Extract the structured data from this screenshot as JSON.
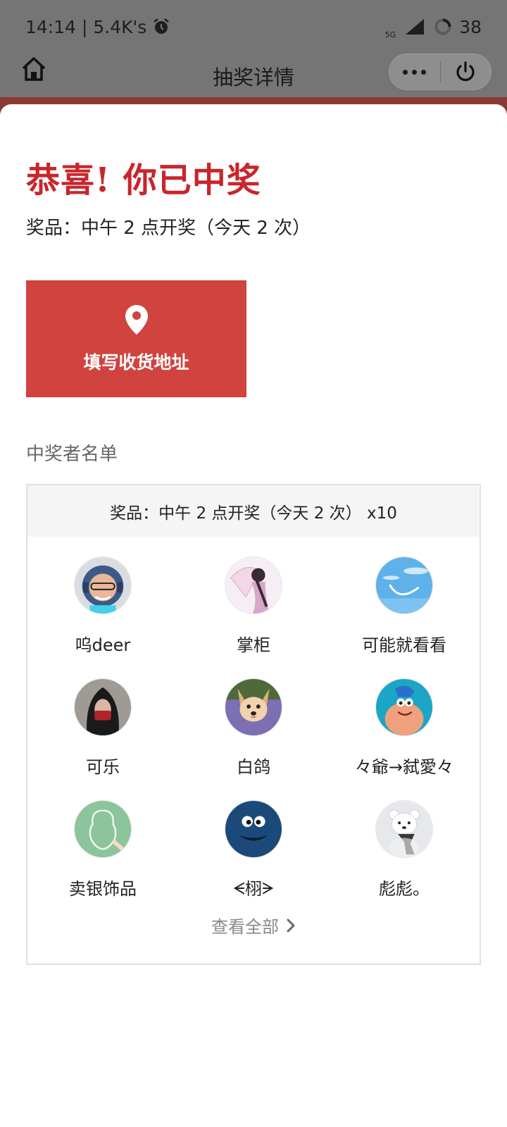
{
  "status_bar": {
    "time_speed": "14:14 | 5.4K's",
    "network": "5G",
    "battery": "38",
    "icons": [
      "alarm-icon",
      "signal-icon",
      "battery-icon"
    ]
  },
  "nav": {
    "title": "抽奖详情",
    "home_icon": "home-icon",
    "more_icon": "more-icon",
    "power_icon": "power-icon"
  },
  "result": {
    "headline": "恭喜! 你已中奖",
    "prize_line": "奖品：中午 2 点开奖（今天 2 次）",
    "address_button_label": "填写收货地址",
    "address_icon": "location-pin-icon",
    "colors": {
      "headline": "#c9252b",
      "button": "#d0433f"
    }
  },
  "winners": {
    "section_title": "中奖者名单",
    "box_header": "奖品：中午 2 点开奖（今天 2 次） x10",
    "list": [
      {
        "name": "呜deer",
        "avatar": "astronaut-avatar"
      },
      {
        "name": "掌柜",
        "avatar": "girl-umbrella-avatar"
      },
      {
        "name": "可能就看看",
        "avatar": "blue-sky-avatar"
      },
      {
        "name": "可乐",
        "avatar": "hooded-figure-avatar"
      },
      {
        "name": "白鸽",
        "avatar": "chihuahua-avatar"
      },
      {
        "name": "々爺→弑愛々",
        "avatar": "patrick-star-avatar"
      },
      {
        "name": "卖银饰品",
        "avatar": "chalk-drawing-avatar"
      },
      {
        "name": "ᗕ栩ᗒ",
        "avatar": "cookie-monster-avatar"
      },
      {
        "name": "彪彪。",
        "avatar": "snow-bear-avatar"
      }
    ],
    "view_all_label": "查看全部",
    "view_all_icon": "chevron-right-icon"
  }
}
